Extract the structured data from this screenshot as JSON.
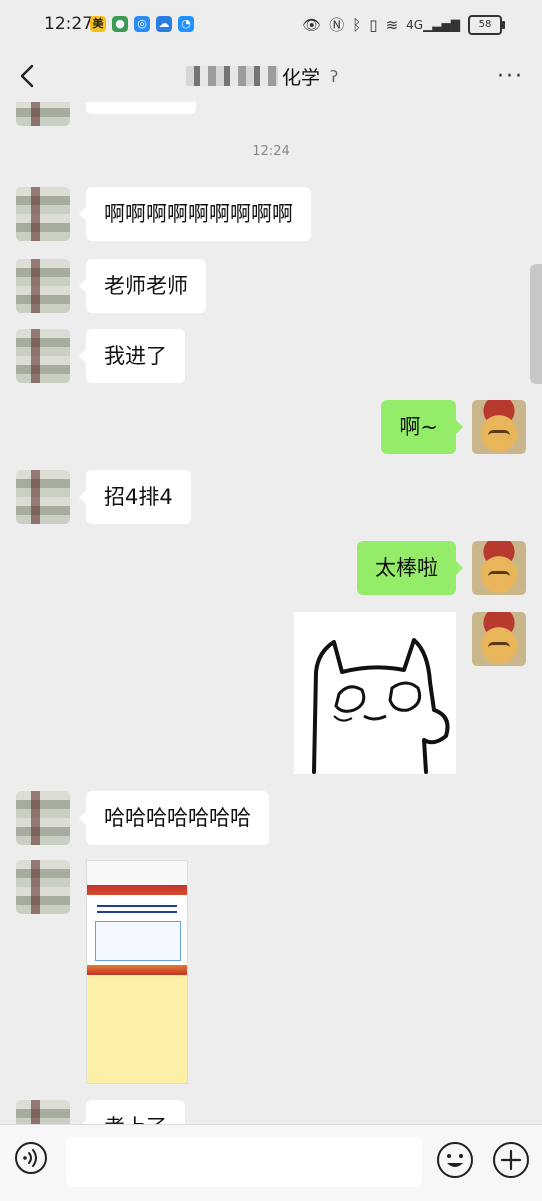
{
  "status_bar": {
    "time": "12:27",
    "app_icons": [
      "meituan-icon",
      "vpn-icon",
      "browser-icon",
      "cloud-icon",
      "qq-icon"
    ],
    "meituan_label": "美",
    "battery": "58",
    "network": "4G"
  },
  "header": {
    "title_suffix": "化学",
    "back_icon": "chevron-left-icon",
    "more_label": "···"
  },
  "chat": {
    "timestamp": "12:24",
    "messages": [
      {
        "side": "left",
        "text": "啊啊啊啊啊啊啊啊啊"
      },
      {
        "side": "left",
        "text": "老师老师"
      },
      {
        "side": "left",
        "text": "我进了"
      },
      {
        "side": "right",
        "text": "啊~"
      },
      {
        "side": "left",
        "text": "招4排4"
      },
      {
        "side": "right",
        "text": "太棒啦"
      },
      {
        "side": "right",
        "type": "sticker",
        "text": ""
      },
      {
        "side": "left",
        "text": "哈哈哈哈哈哈哈"
      },
      {
        "side": "left",
        "type": "image",
        "text": ""
      },
      {
        "side": "left",
        "text": "考上了"
      }
    ]
  },
  "input_bar": {
    "placeholder": "",
    "value": ""
  },
  "colors": {
    "background": "#ededed",
    "bubble_self": "#95ec69",
    "bubble_other": "#ffffff"
  }
}
